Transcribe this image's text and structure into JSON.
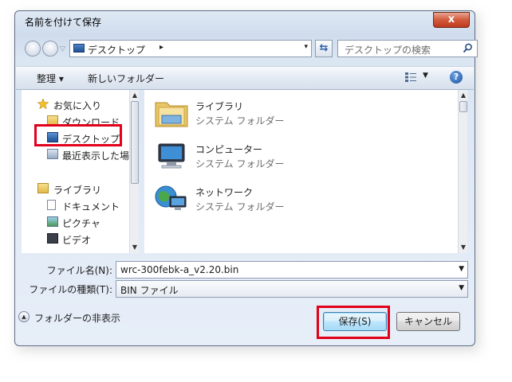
{
  "window": {
    "title": "名前を付けて保存",
    "close_glyph": "x"
  },
  "address": {
    "path": "デスクトップ",
    "chevron": "▸",
    "drop": "▾"
  },
  "search": {
    "placeholder": "デスクトップの検索"
  },
  "toolbar": {
    "organize": "整理 ▾",
    "new_folder": "新しいフォルダー",
    "help": "?"
  },
  "navpane": {
    "items": [
      {
        "label": "お気に入り",
        "icon": "star-icon"
      },
      {
        "label": "ダウンロード",
        "icon": "download-folder-icon"
      },
      {
        "label": "デスクトップ",
        "icon": "desktop-icon"
      },
      {
        "label": "最近表示した場所",
        "icon": "recent-places-icon"
      },
      {
        "label": "ライブラリ",
        "icon": "library-icon"
      },
      {
        "label": "ドキュメント",
        "icon": "document-icon"
      },
      {
        "label": "ピクチャ",
        "icon": "picture-icon"
      },
      {
        "label": "ビデオ",
        "icon": "video-icon"
      }
    ]
  },
  "content": {
    "items": [
      {
        "name": "ライブラリ",
        "type": "システム フォルダー",
        "icon": "library-folder-icon"
      },
      {
        "name": "コンピューター",
        "type": "システム フォルダー",
        "icon": "computer-icon"
      },
      {
        "name": "ネットワーク",
        "type": "システム フォルダー",
        "icon": "network-icon"
      }
    ]
  },
  "form": {
    "filename_label": "ファイル名(N):",
    "filename_value": "wrc-300febk-a_v2.20.bin",
    "filetype_label": "ファイルの種類(T):",
    "filetype_value": "BIN ファイル"
  },
  "footer": {
    "hide_folders": "フォルダーの非表示",
    "save_button": "保存(S)",
    "cancel_button": "キャンセル"
  },
  "colors": {
    "highlight": "#e2001a",
    "window_frame": "#5d6e86",
    "accent": "#3c7fb1"
  }
}
